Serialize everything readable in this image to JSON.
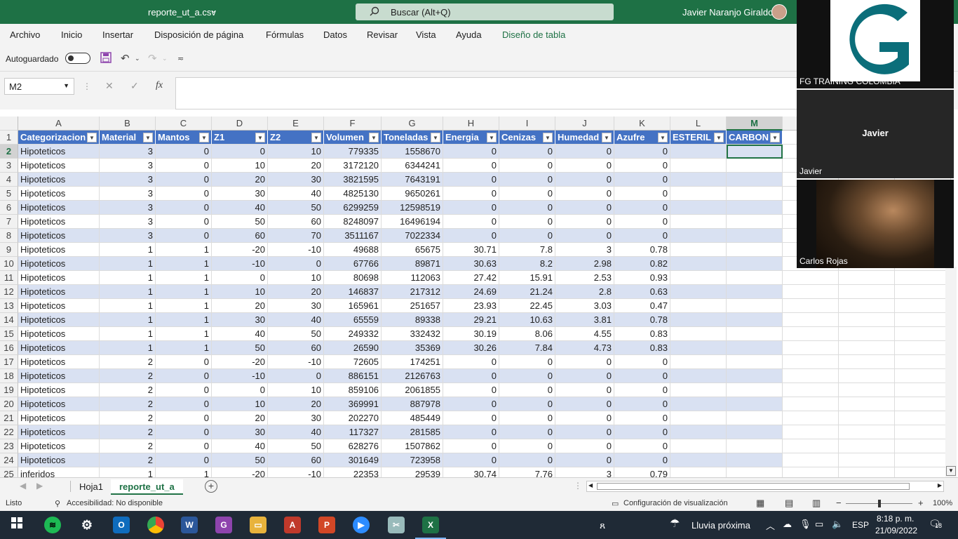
{
  "titlebar": {
    "filename": "reporte_ut_a.csv",
    "search_label": "Buscar (Alt+Q)",
    "user_name": "Javier Naranjo Giraldo"
  },
  "menu": [
    "Archivo",
    "Inicio",
    "Insertar",
    "Disposición de página",
    "Fórmulas",
    "Datos",
    "Revisar",
    "Vista",
    "Ayuda",
    "Diseño de tabla"
  ],
  "qat": {
    "autosave_label": "Autoguardado"
  },
  "formula": {
    "name_box": "M2",
    "fx": "fx",
    "cancel": "✕",
    "confirm": "✓"
  },
  "columns": [
    "A",
    "B",
    "C",
    "D",
    "E",
    "F",
    "G",
    "H",
    "I",
    "J",
    "K",
    "L",
    "M"
  ],
  "table_headers": [
    "Categorizacion",
    "Material",
    "Mantos",
    "Z1",
    "Z2",
    "Volumen",
    "Toneladas",
    "Energia",
    "Cenizas",
    "Humedad",
    "Azufre",
    "ESTERIL",
    "CARBON"
  ],
  "rows": [
    [
      "Hipoteticos",
      "3",
      "0",
      "0",
      "10",
      "779335",
      "1558670",
      "0",
      "0",
      "0",
      "0",
      "",
      ""
    ],
    [
      "Hipoteticos",
      "3",
      "0",
      "10",
      "20",
      "3172120",
      "6344241",
      "0",
      "0",
      "0",
      "0",
      "",
      ""
    ],
    [
      "Hipoteticos",
      "3",
      "0",
      "20",
      "30",
      "3821595",
      "7643191",
      "0",
      "0",
      "0",
      "0",
      "",
      ""
    ],
    [
      "Hipoteticos",
      "3",
      "0",
      "30",
      "40",
      "4825130",
      "9650261",
      "0",
      "0",
      "0",
      "0",
      "",
      ""
    ],
    [
      "Hipoteticos",
      "3",
      "0",
      "40",
      "50",
      "6299259",
      "12598519",
      "0",
      "0",
      "0",
      "0",
      "",
      ""
    ],
    [
      "Hipoteticos",
      "3",
      "0",
      "50",
      "60",
      "8248097",
      "16496194",
      "0",
      "0",
      "0",
      "0",
      "",
      ""
    ],
    [
      "Hipoteticos",
      "3",
      "0",
      "60",
      "70",
      "3511167",
      "7022334",
      "0",
      "0",
      "0",
      "0",
      "",
      ""
    ],
    [
      "Hipoteticos",
      "1",
      "1",
      "-20",
      "-10",
      "49688",
      "65675",
      "30.71",
      "7.8",
      "3",
      "0.78",
      "",
      ""
    ],
    [
      "Hipoteticos",
      "1",
      "1",
      "-10",
      "0",
      "67766",
      "89871",
      "30.63",
      "8.2",
      "2.98",
      "0.82",
      "",
      ""
    ],
    [
      "Hipoteticos",
      "1",
      "1",
      "0",
      "10",
      "80698",
      "112063",
      "27.42",
      "15.91",
      "2.53",
      "0.93",
      "",
      ""
    ],
    [
      "Hipoteticos",
      "1",
      "1",
      "10",
      "20",
      "146837",
      "217312",
      "24.69",
      "21.24",
      "2.8",
      "0.63",
      "",
      ""
    ],
    [
      "Hipoteticos",
      "1",
      "1",
      "20",
      "30",
      "165961",
      "251657",
      "23.93",
      "22.45",
      "3.03",
      "0.47",
      "",
      ""
    ],
    [
      "Hipoteticos",
      "1",
      "1",
      "30",
      "40",
      "65559",
      "89338",
      "29.21",
      "10.63",
      "3.81",
      "0.78",
      "",
      ""
    ],
    [
      "Hipoteticos",
      "1",
      "1",
      "40",
      "50",
      "249332",
      "332432",
      "30.19",
      "8.06",
      "4.55",
      "0.83",
      "",
      ""
    ],
    [
      "Hipoteticos",
      "1",
      "1",
      "50",
      "60",
      "26590",
      "35369",
      "30.26",
      "7.84",
      "4.73",
      "0.83",
      "",
      ""
    ],
    [
      "Hipoteticos",
      "2",
      "0",
      "-20",
      "-10",
      "72605",
      "174251",
      "0",
      "0",
      "0",
      "0",
      "",
      ""
    ],
    [
      "Hipoteticos",
      "2",
      "0",
      "-10",
      "0",
      "886151",
      "2126763",
      "0",
      "0",
      "0",
      "0",
      "",
      ""
    ],
    [
      "Hipoteticos",
      "2",
      "0",
      "0",
      "10",
      "859106",
      "2061855",
      "0",
      "0",
      "0",
      "0",
      "",
      ""
    ],
    [
      "Hipoteticos",
      "2",
      "0",
      "10",
      "20",
      "369991",
      "887978",
      "0",
      "0",
      "0",
      "0",
      "",
      ""
    ],
    [
      "Hipoteticos",
      "2",
      "0",
      "20",
      "30",
      "202270",
      "485449",
      "0",
      "0",
      "0",
      "0",
      "",
      ""
    ],
    [
      "Hipoteticos",
      "2",
      "0",
      "30",
      "40",
      "117327",
      "281585",
      "0",
      "0",
      "0",
      "0",
      "",
      ""
    ],
    [
      "Hipoteticos",
      "2",
      "0",
      "40",
      "50",
      "628276",
      "1507862",
      "0",
      "0",
      "0",
      "0",
      "",
      ""
    ],
    [
      "Hipoteticos",
      "2",
      "0",
      "50",
      "60",
      "301649",
      "723958",
      "0",
      "0",
      "0",
      "0",
      "",
      ""
    ],
    [
      "inferidos",
      "1",
      "1",
      "-20",
      "-10",
      "22353",
      "29539",
      "30.74",
      "7.76",
      "3",
      "0.79",
      "",
      ""
    ]
  ],
  "sheets": [
    "Hoja1",
    "reporte_ut_a"
  ],
  "status": {
    "ready": "Listo",
    "accessibility": "Accesibilidad: No disponible",
    "display_settings": "Configuración de visualización",
    "zoom": "100%"
  },
  "video": {
    "tile1_name": "FG TRAINING COLOMBIA",
    "tile2_center": "Javier",
    "tile2_name": "Javier",
    "tile3_name": "Carlos Rojas"
  },
  "taskbar": {
    "weather": "Lluvia próxima",
    "lang": "ESP",
    "time": "8:18 p. m.",
    "date": "21/09/2022",
    "notif_count": "18"
  },
  "colors": {
    "excel_green": "#1e7145",
    "table_header": "#4472c4",
    "band": "#d9e1f2"
  }
}
